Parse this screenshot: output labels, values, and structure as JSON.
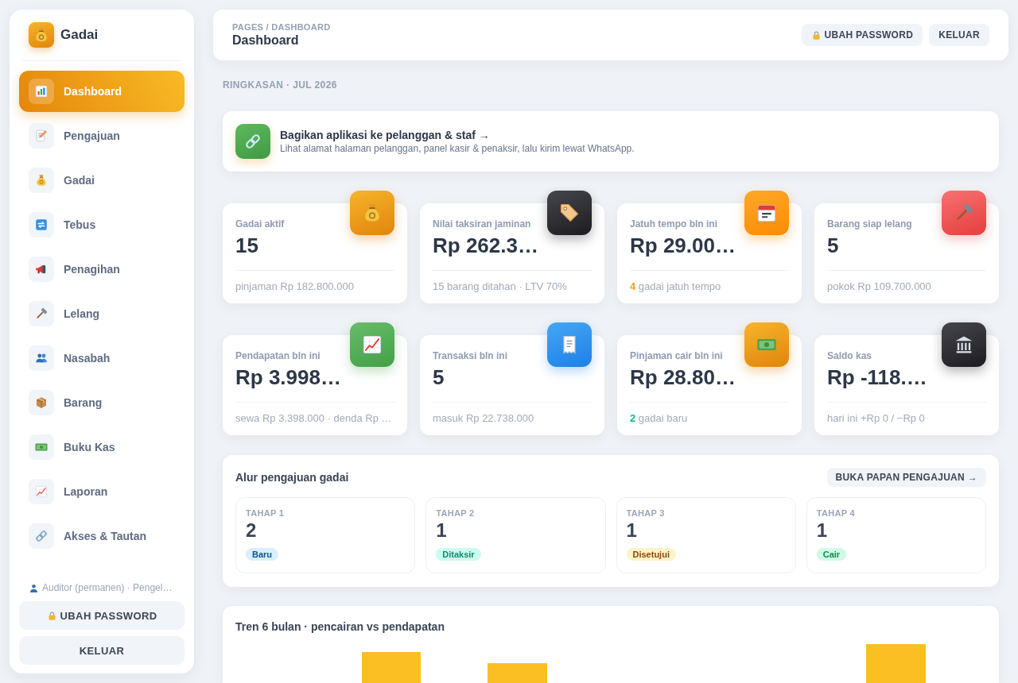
{
  "sidebar": {
    "brand": "Gadai",
    "items": [
      {
        "label": "Dashboard",
        "selected": true
      },
      {
        "label": "Pengajuan",
        "selected": false
      },
      {
        "label": "Gadai",
        "selected": false
      },
      {
        "label": "Tebus",
        "selected": false
      },
      {
        "label": "Penagihan",
        "selected": false
      },
      {
        "label": "Lelang",
        "selected": false
      },
      {
        "label": "Nasabah",
        "selected": false
      },
      {
        "label": "Barang",
        "selected": false
      },
      {
        "label": "Buku Kas",
        "selected": false
      },
      {
        "label": "Laporan",
        "selected": false
      },
      {
        "label": "Akses & Tautan",
        "selected": false
      }
    ],
    "user": "Auditor (permanen) · Pengel…",
    "buttons": [
      "UBAH PASSWORD",
      "KELUAR"
    ]
  },
  "header": {
    "breadcrumb": "PAGES / DASHBOARD",
    "title": "Dashboard",
    "buttons": [
      "UBAH PASSWORD",
      "KELUAR"
    ]
  },
  "summary_label": "RINGKASAN · JUL 2026",
  "share_banner": {
    "title": "Bagikan aplikasi ke pelanggan & staf →",
    "subtitle": "Lihat alamat halaman pelanggan, panel kasir & penaksir, lalu kirim lewat WhatsApp."
  },
  "stats": [
    {
      "label": "Gadai aktif",
      "value": "15",
      "note": "pinjaman Rp 182.800.000"
    },
    {
      "label": "Nilai taksiran jaminan",
      "value": "Rp 262.3…",
      "note": "15 barang ditahan · LTV 70%"
    },
    {
      "label": "Jatuh tempo bln ini",
      "value": "Rp 29.00…",
      "note": "**4** gadai jatuh tempo",
      "color": "#f59e0b"
    },
    {
      "label": "Barang siap lelang",
      "value": "5",
      "note": "pokok Rp 109.700.000"
    },
    {
      "label": "Pendapatan bln ini",
      "value": "Rp 3.998…",
      "note": "sewa Rp 3.398.000 · denda Rp …"
    },
    {
      "label": "Transaksi bln ini",
      "value": "5",
      "note": "masuk Rp 22.738.000"
    },
    {
      "label": "Pinjaman cair bln ini",
      "value": "Rp 28.80…",
      "note": "**2** gadai baru",
      "color": "#10b981"
    },
    {
      "label": "Saldo kas",
      "value": "Rp -118.…",
      "note": "hari ini +Rp 0 / −Rp 0"
    }
  ],
  "pipeline": {
    "title": "Alur pengajuan gadai",
    "button": "BUKA PAPAN PENGAJUAN →",
    "stages": [
      {
        "step": "TAHAP 1",
        "count": "2",
        "status": "Baru",
        "color": "#dbeefd"
      },
      {
        "step": "TAHAP 2",
        "count": "1",
        "status": "Ditaksir",
        "color": "#ccfbef"
      },
      {
        "step": "TAHAP 3",
        "count": "1",
        "status": "Disetujui",
        "color": "#fef3c7"
      },
      {
        "step": "TAHAP 4",
        "count": "1",
        "status": "Cair",
        "color": "#d1fae5"
      }
    ]
  },
  "trend_chart": {
    "title": "Tren 6 bulan · pencairan vs pendapatan"
  }
}
